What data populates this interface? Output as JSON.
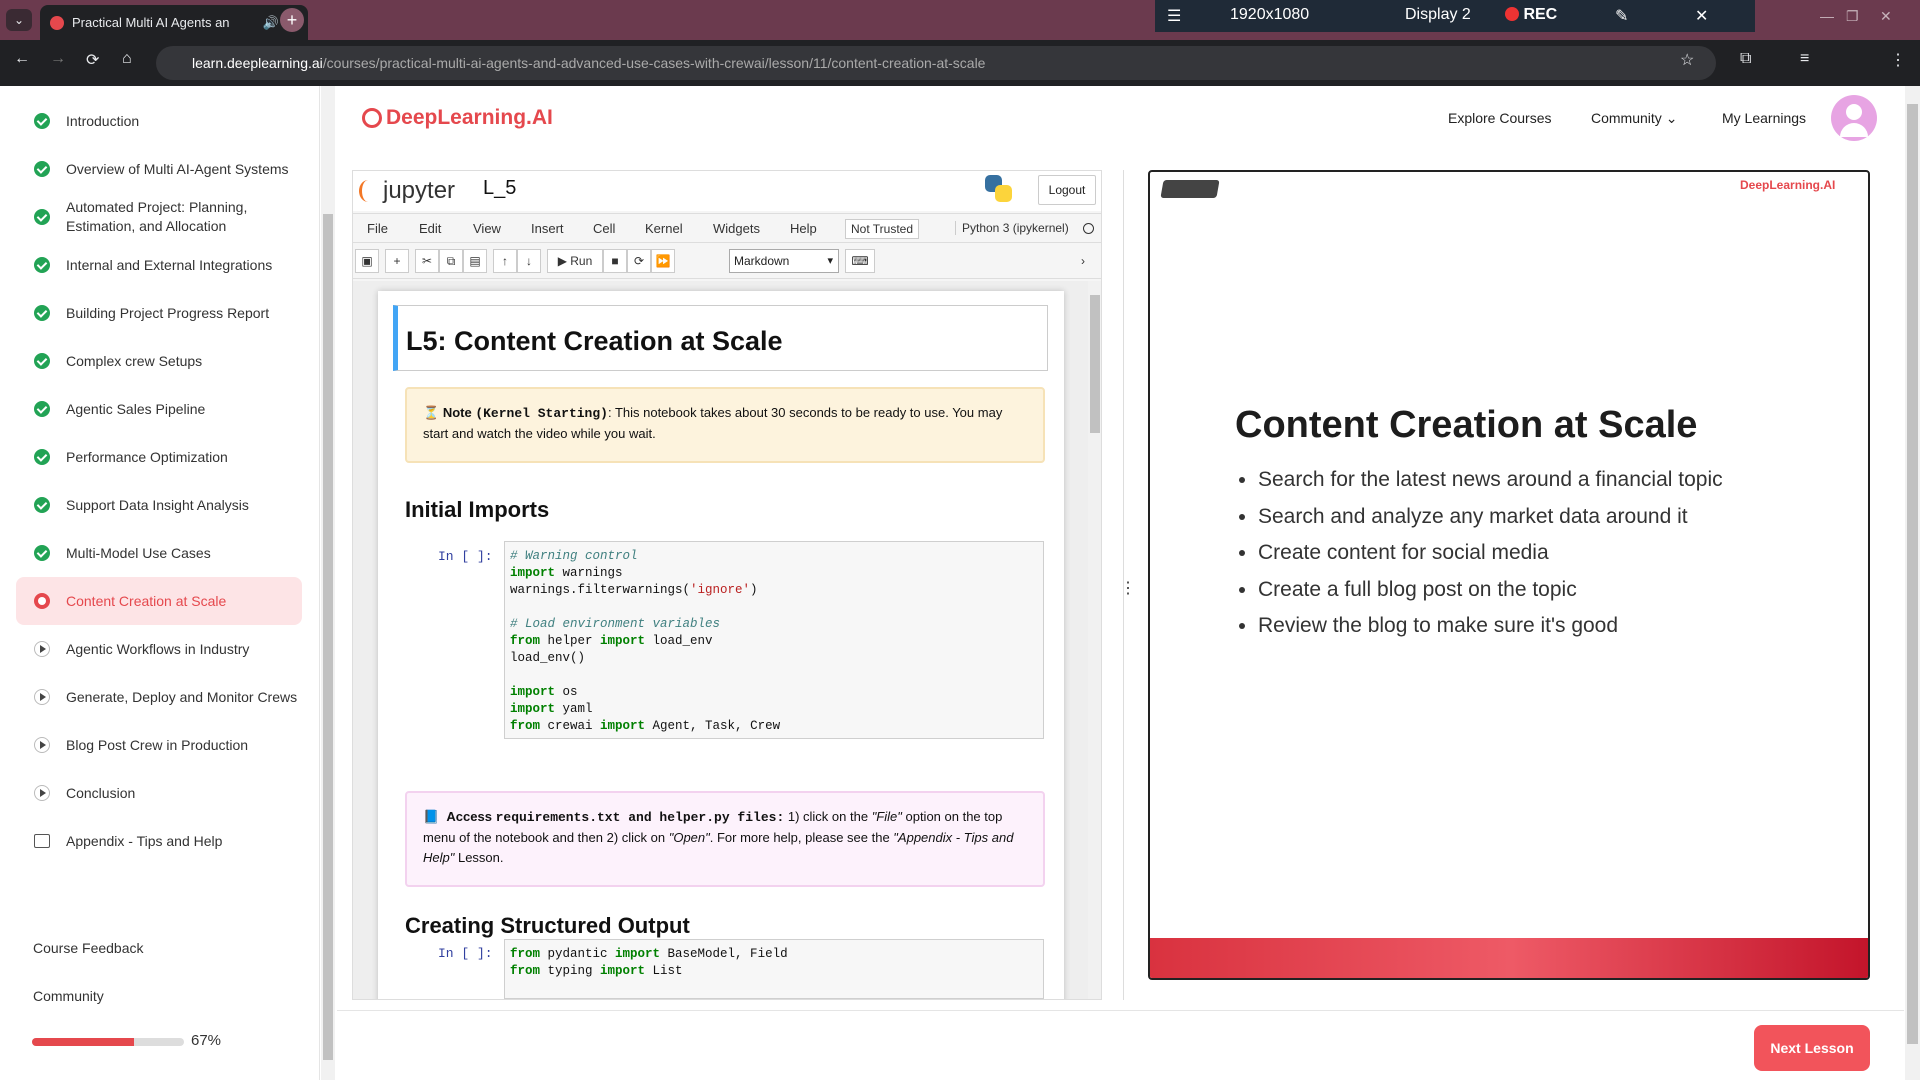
{
  "browser": {
    "tab_title": "Practical Multi AI Agents an",
    "url_domain": "learn.deeplearning.ai",
    "url_path": "/courses/practical-multi-ai-agents-and-advanced-use-cases-with-crewai/lesson/11/content-creation-at-scale",
    "recorder": {
      "resolution": "1920x1080",
      "display": "Display 2",
      "rec": "REC"
    }
  },
  "header": {
    "logo": "DeepLearning.AI",
    "nav": [
      "Explore Courses",
      "Community",
      "My Learnings"
    ]
  },
  "sidebar": {
    "items": [
      {
        "label": "Introduction",
        "status": "done"
      },
      {
        "label": "Overview of Multi AI-Agent Systems",
        "status": "done"
      },
      {
        "label": "Automated Project: Planning, Estimation, and Allocation",
        "status": "done"
      },
      {
        "label": "Internal and External Integrations",
        "status": "done"
      },
      {
        "label": "Building Project Progress Report",
        "status": "done"
      },
      {
        "label": "Complex crew Setups",
        "status": "done"
      },
      {
        "label": "Agentic Sales Pipeline",
        "status": "done"
      },
      {
        "label": "Performance Optimization",
        "status": "done"
      },
      {
        "label": "Support Data Insight Analysis",
        "status": "done"
      },
      {
        "label": "Multi-Model Use Cases",
        "status": "done"
      },
      {
        "label": "Content Creation at Scale",
        "status": "current"
      },
      {
        "label": "Agentic Workflows in Industry",
        "status": "todo"
      },
      {
        "label": "Generate, Deploy and Monitor Crews",
        "status": "todo"
      },
      {
        "label": "Blog Post Crew in Production",
        "status": "todo"
      },
      {
        "label": "Conclusion",
        "status": "todo"
      },
      {
        "label": "Appendix - Tips and Help",
        "status": "appendix"
      }
    ],
    "footer": {
      "feedback": "Course Feedback",
      "community": "Community",
      "progress": 0.67,
      "progress_label": "67%"
    }
  },
  "jupyter": {
    "brand": "jupyter",
    "notebook": "L_5",
    "logout": "Logout",
    "menu": [
      "File",
      "Edit",
      "View",
      "Insert",
      "Cell",
      "Kernel",
      "Widgets",
      "Help"
    ],
    "trust": "Not Trusted",
    "kernel": "Python 3 (ipykernel)",
    "run_label": "Run",
    "cell_type": "Markdown",
    "title": "L5: Content Creation at Scale",
    "note_label": "Note",
    "note_code": "(Kernel Starting)",
    "note_text": ": This notebook takes about 30 seconds to be ready to use. You may start and watch the video while you wait.",
    "section1": "Initial Imports",
    "prompt": "In [ ]:",
    "access_label": "Access",
    "access_files": "requirements.txt and helper.py files:",
    "access_text1": " 1) click on the ",
    "access_file": "\"File\"",
    "access_text2": " option on the top menu of the notebook and then 2) click on ",
    "access_open": "\"Open\"",
    "access_text3": ". For more help, please see the ",
    "access_appendix": "\"Appendix - Tips and Help\"",
    "access_text4": " Lesson.",
    "section2": "Creating Structured Output"
  },
  "slide": {
    "brand": "DeepLearning.AI",
    "title": "Content Creation at Scale",
    "bullets": [
      "Search for the latest news around a financial topic",
      "Search and analyze any market data around it",
      "Create content for social media",
      "Create a full blog post on the topic",
      "Review the blog to make sure it's good"
    ]
  },
  "footer": {
    "next": "Next Lesson"
  },
  "colors": {
    "accent": "#e5484d",
    "done": "#22a355"
  }
}
